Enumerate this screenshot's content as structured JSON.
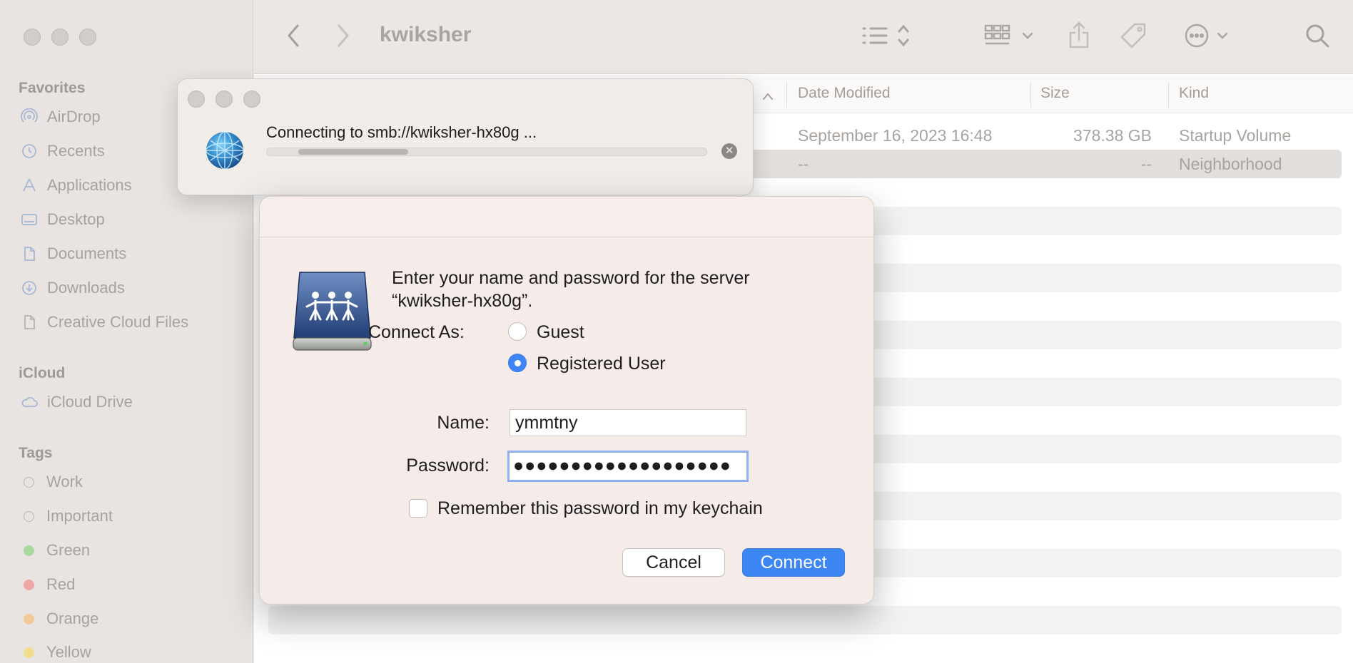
{
  "finder": {
    "window_title": "kwiksher",
    "sidebar": {
      "favorites_header": "Favorites",
      "favorites": [
        {
          "label": "AirDrop",
          "icon": "airdrop-icon"
        },
        {
          "label": "Recents",
          "icon": "clock-icon"
        },
        {
          "label": "Applications",
          "icon": "applications-icon"
        },
        {
          "label": "Desktop",
          "icon": "desktop-icon"
        },
        {
          "label": "Documents",
          "icon": "document-icon"
        },
        {
          "label": "Downloads",
          "icon": "download-icon"
        },
        {
          "label": "Creative Cloud Files",
          "icon": "file-icon"
        }
      ],
      "icloud_header": "iCloud",
      "icloud": [
        {
          "label": "iCloud Drive",
          "icon": "cloud-icon"
        }
      ],
      "tags_header": "Tags",
      "tags": [
        {
          "label": "Work",
          "color": ""
        },
        {
          "label": "Important",
          "color": ""
        },
        {
          "label": "Green",
          "color": "#a8d8a0"
        },
        {
          "label": "Red",
          "color": "#f0a8a4"
        },
        {
          "label": "Orange",
          "color": "#f3c99a"
        },
        {
          "label": "Yellow",
          "color": "#f1dc8f"
        }
      ]
    },
    "columns": {
      "date": "Date Modified",
      "size": "Size",
      "kind": "Kind"
    },
    "rows": [
      {
        "date": "September 16, 2023 16:48",
        "size": "378.38 GB",
        "kind": "Startup Volume"
      },
      {
        "date": "--",
        "size": "--",
        "kind": "Neighborhood"
      }
    ]
  },
  "connecting": {
    "message": "Connecting to smb://kwiksher-hx80g ...",
    "progress": 0.25
  },
  "auth_dialog": {
    "prompt_line1": "Enter your name and password for the server",
    "prompt_line2": "“kwiksher-hx80g”.",
    "connect_as_label": "Connect As:",
    "guest_label": "Guest",
    "registered_label": "Registered User",
    "selected": "Registered User",
    "name_label": "Name:",
    "name_value": "ymmtny",
    "password_label": "Password:",
    "password_value": "●●●●●●●●●●●●●●●●●●●",
    "remember_label": "Remember this password in my keychain",
    "remember_checked": false,
    "cancel_label": "Cancel",
    "connect_label": "Connect"
  }
}
